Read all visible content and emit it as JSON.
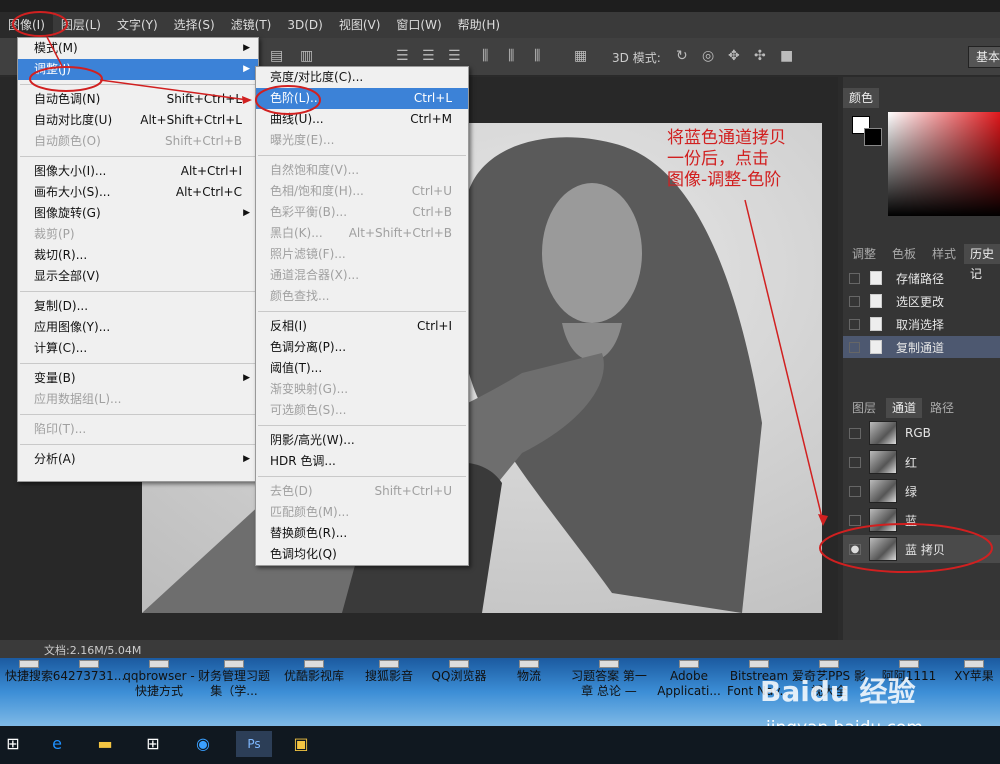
{
  "menubar": {
    "items": [
      "图像(I)",
      "图层(L)",
      "文字(Y)",
      "选择(S)",
      "滤镜(T)",
      "3D(D)",
      "视图(V)",
      "窗口(W)",
      "帮助(H)"
    ]
  },
  "optbar": {
    "mode_label": "3D 模式:",
    "workspace": "基本"
  },
  "status": {
    "doc": "文档:2.16M/5.04M"
  },
  "image_menu": {
    "items": [
      {
        "label": "模式(M)",
        "shortcut": "",
        "arrow": true,
        "disabled": false
      },
      {
        "label": "调整(J)",
        "shortcut": "",
        "arrow": true,
        "disabled": false,
        "highlight": true
      },
      {
        "label": "自动色调(N)",
        "shortcut": "Shift+Ctrl+L",
        "disabled": false
      },
      {
        "label": "自动对比度(U)",
        "shortcut": "Alt+Shift+Ctrl+L",
        "disabled": false
      },
      {
        "label": "自动颜色(O)",
        "shortcut": "Shift+Ctrl+B",
        "disabled": true
      },
      {
        "label": "图像大小(I)...",
        "shortcut": "Alt+Ctrl+I",
        "disabled": false
      },
      {
        "label": "画布大小(S)...",
        "shortcut": "Alt+Ctrl+C",
        "disabled": false
      },
      {
        "label": "图像旋转(G)",
        "shortcut": "",
        "arrow": true,
        "disabled": false
      },
      {
        "label": "裁剪(P)",
        "shortcut": "",
        "disabled": true
      },
      {
        "label": "裁切(R)...",
        "shortcut": "",
        "disabled": false
      },
      {
        "label": "显示全部(V)",
        "shortcut": "",
        "disabled": false
      },
      {
        "label": "复制(D)...",
        "shortcut": "",
        "disabled": false
      },
      {
        "label": "应用图像(Y)...",
        "shortcut": "",
        "disabled": false
      },
      {
        "label": "计算(C)...",
        "shortcut": "",
        "disabled": false
      },
      {
        "label": "变量(B)",
        "shortcut": "",
        "arrow": true,
        "disabled": false
      },
      {
        "label": "应用数据组(L)...",
        "shortcut": "",
        "disabled": true
      },
      {
        "label": "陷印(T)...",
        "shortcut": "",
        "disabled": true
      },
      {
        "label": "分析(A)",
        "shortcut": "",
        "arrow": true,
        "disabled": false
      }
    ]
  },
  "adjust_menu": {
    "items": [
      {
        "label": "亮度/对比度(C)...",
        "shortcut": "",
        "disabled": false
      },
      {
        "label": "色阶(L)...",
        "shortcut": "Ctrl+L",
        "disabled": false,
        "highlight": true
      },
      {
        "label": "曲线(U)...",
        "shortcut": "Ctrl+M",
        "disabled": false
      },
      {
        "label": "曝光度(E)...",
        "shortcut": "",
        "disabled": true
      },
      {
        "label": "自然饱和度(V)...",
        "shortcut": "",
        "disabled": true
      },
      {
        "label": "色相/饱和度(H)...",
        "shortcut": "Ctrl+U",
        "disabled": true
      },
      {
        "label": "色彩平衡(B)...",
        "shortcut": "Ctrl+B",
        "disabled": true
      },
      {
        "label": "黑白(K)...",
        "shortcut": "Alt+Shift+Ctrl+B",
        "disabled": true
      },
      {
        "label": "照片滤镜(F)...",
        "shortcut": "",
        "disabled": true
      },
      {
        "label": "通道混合器(X)...",
        "shortcut": "",
        "disabled": true
      },
      {
        "label": "颜色查找...",
        "shortcut": "",
        "disabled": true
      },
      {
        "label": "反相(I)",
        "shortcut": "Ctrl+I",
        "disabled": false
      },
      {
        "label": "色调分离(P)...",
        "shortcut": "",
        "disabled": false
      },
      {
        "label": "阈值(T)...",
        "shortcut": "",
        "disabled": false
      },
      {
        "label": "渐变映射(G)...",
        "shortcut": "",
        "disabled": true
      },
      {
        "label": "可选颜色(S)...",
        "shortcut": "",
        "disabled": true
      },
      {
        "label": "阴影/高光(W)...",
        "shortcut": "",
        "disabled": false
      },
      {
        "label": "HDR 色调...",
        "shortcut": "",
        "disabled": false
      },
      {
        "label": "去色(D)",
        "shortcut": "Shift+Ctrl+U",
        "disabled": true
      },
      {
        "label": "匹配颜色(M)...",
        "shortcut": "",
        "disabled": true
      },
      {
        "label": "替换颜色(R)...",
        "shortcut": "",
        "disabled": false
      },
      {
        "label": "色调均化(Q)",
        "shortcut": "",
        "disabled": false
      }
    ]
  },
  "annotation": [
    "将蓝色通道拷贝",
    "一份后，点击",
    "图像-调整-色阶"
  ],
  "panels": {
    "color_tab": "颜色",
    "history_tabs": [
      "调整",
      "色板",
      "样式",
      "历史记"
    ],
    "history_items": [
      "存储路径",
      "选区更改",
      "取消选择",
      "复制通道"
    ],
    "layer_tabs": [
      "图层",
      "通道",
      "路径"
    ],
    "channels": [
      "RGB",
      "红",
      "绿",
      "蓝",
      "蓝 拷贝"
    ]
  },
  "desktop": {
    "icons": [
      "快捷搜索",
      "64273731...",
      "qqbrowser - 快捷方式",
      "财务管理习题集（学...",
      "优酷影视库",
      "搜狐影音",
      "QQ浏览器",
      "物流",
      "习题答案 第一章 总论 —",
      "Adobe Applicati...",
      "Bitstream Font Nav...",
      "爱奇艺PPS 影视大全",
      "阿阿1111",
      "XY苹果"
    ],
    "watermark": "Baidu 经验",
    "watermark_url": "jingyan.baidu.com"
  },
  "colors": {
    "accent": "#3c82d7",
    "annotation": "#d12020"
  }
}
